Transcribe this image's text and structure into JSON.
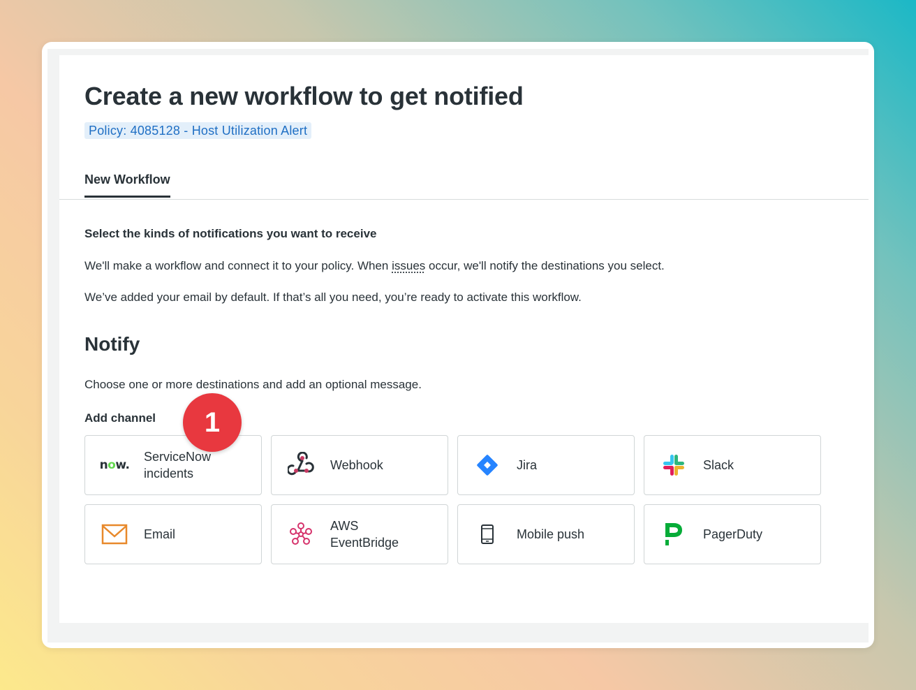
{
  "page": {
    "title": "Create a new workflow to get notified",
    "policy_badge": "Policy: 4085128 - Host Utilization Alert"
  },
  "tabs": [
    {
      "label": "New Workflow",
      "active": true
    }
  ],
  "intro": {
    "heading": "Select the kinds of notifications you want to receive",
    "para1_before": "We'll make a workflow and connect it to your policy. When ",
    "para1_link": "issues",
    "para1_after": " occur, we'll notify the destinations you select.",
    "para2": "We’ve added your email by default. If that’s all you need, you’re ready to activate this workflow."
  },
  "notify": {
    "title": "Notify",
    "description": "Choose one or more destinations and add an optional message.",
    "add_channel_label": "Add channel"
  },
  "channels": [
    {
      "label": "ServiceNow incidents",
      "icon": "servicenow-logo",
      "logo_text": "now."
    },
    {
      "label": "Webhook",
      "icon": "webhook-icon"
    },
    {
      "label": "Jira",
      "icon": "jira-icon"
    },
    {
      "label": "Slack",
      "icon": "slack-icon"
    },
    {
      "label": "Email",
      "icon": "envelope-icon"
    },
    {
      "label": "AWS EventBridge",
      "icon": "eventbridge-icon"
    },
    {
      "label": "Mobile push",
      "icon": "mobile-phone-icon"
    },
    {
      "label": "PagerDuty",
      "icon": "pagerduty-icon"
    }
  ],
  "step_badge": "1",
  "colors": {
    "text": "#293238",
    "badge_bg": "#e3effa",
    "badge_text": "#1f6fc4",
    "step_badge": "#e8383f",
    "webhook": "#c73a63",
    "jira": "#2684ff",
    "email": "#e8892b",
    "eventbridge": "#d6336c",
    "pagerduty": "#06ac38",
    "servicenow_accent": "#62d84e"
  }
}
